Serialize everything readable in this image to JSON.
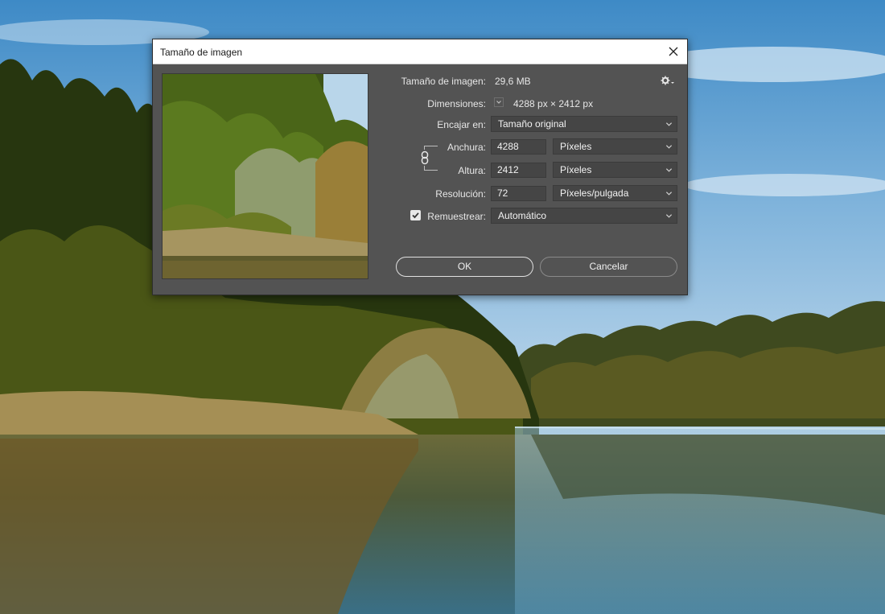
{
  "dialog": {
    "title": "Tamaño de imagen",
    "image_size_label": "Tamaño de imagen:",
    "image_size_value": "29,6 MB",
    "dimensions_label": "Dimensiones:",
    "dimensions_value": "4288 px × 2412 px",
    "fit_label": "Encajar en:",
    "fit_value": "Tamaño original",
    "width_label": "Anchura:",
    "width_value": "4288",
    "width_unit": "Píxeles",
    "height_label": "Altura:",
    "height_value": "2412",
    "height_unit": "Píxeles",
    "resolution_label": "Resolución:",
    "resolution_value": "72",
    "resolution_unit": "Píxeles/pulgada",
    "resample_label": "Remuestrear:",
    "resample_checked": true,
    "resample_value": "Automático",
    "ok_label": "OK",
    "cancel_label": "Cancelar"
  },
  "icons": {
    "close": "close-icon",
    "gear": "gear-icon",
    "link": "chain-link-icon",
    "dropdown": "chevron-down-icon",
    "checkbox": "checkmark-icon"
  },
  "colors": {
    "dialog_bg": "#535353",
    "field_bg": "#454545",
    "titlebar_bg": "#ffffff",
    "text": "#e6e6e6"
  }
}
